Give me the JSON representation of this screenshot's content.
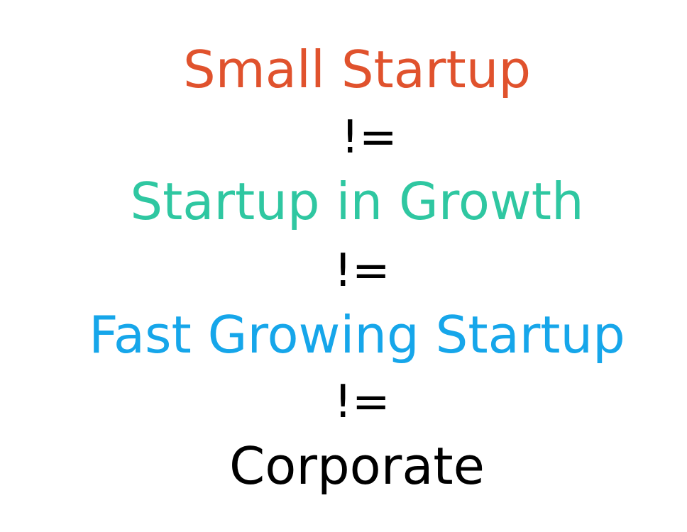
{
  "stages": [
    {
      "label": "Small Startup",
      "color": "#e0522d"
    },
    {
      "label": "Startup in Growth",
      "color": "#2fc7a1"
    },
    {
      "label": "Fast Growing Startup",
      "color": "#16a6ea"
    },
    {
      "label": "Corporate",
      "color": "#000000"
    }
  ],
  "operator": "!="
}
